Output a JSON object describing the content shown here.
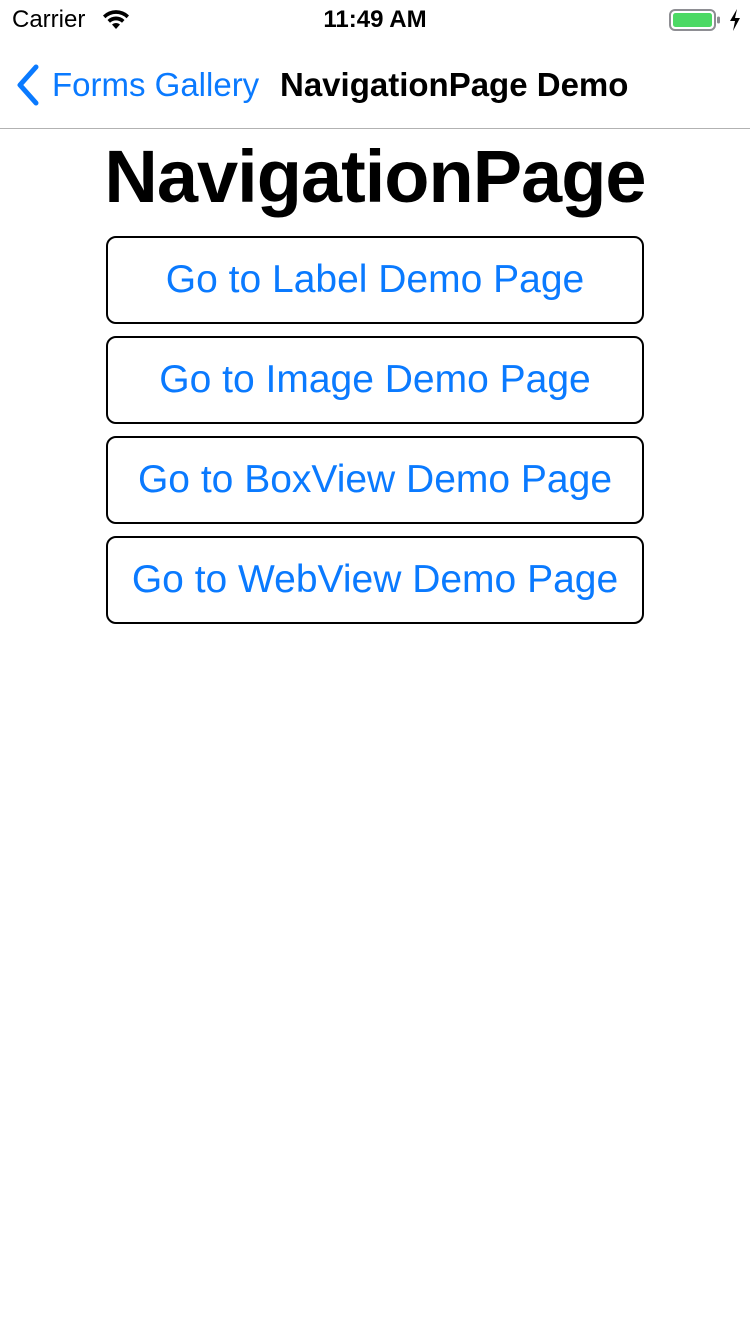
{
  "status_bar": {
    "carrier": "Carrier",
    "time": "11:49 AM",
    "battery_color": "#4cd964"
  },
  "nav_bar": {
    "back_label": "Forms Gallery",
    "title": "NavigationPage Demo",
    "tint_color": "#0a7aff"
  },
  "page": {
    "heading": "NavigationPage",
    "buttons": [
      {
        "label": "Go to Label Demo Page"
      },
      {
        "label": "Go to Image Demo Page"
      },
      {
        "label": "Go to BoxView Demo Page"
      },
      {
        "label": "Go to WebView Demo Page"
      }
    ]
  }
}
